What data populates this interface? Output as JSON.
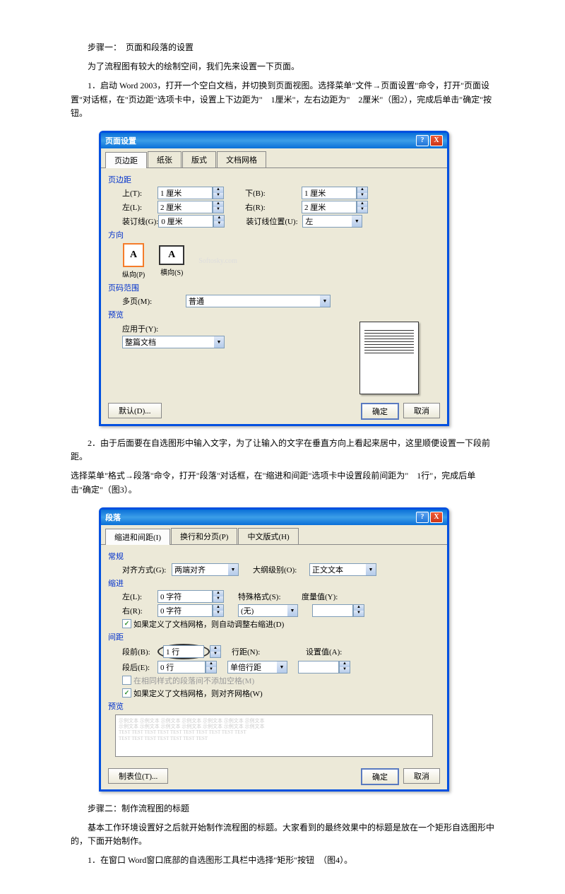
{
  "step1_title": "步骤一：　页面和段落的设置",
  "intro1": "为了流程图有较大的绘制空间，我们先来设置一下页面。",
  "para1": "1．启动 Word 2003，打开一个空白文档，并切换到页面视图。选择菜单\"文件→页面设置\"命令，打开\"页面设置\"对话框，在\"页边距\"选项卡中，设置上下边距为\"　1厘米\"，左右边距为\"　2厘米\"（图2），完成后单击\"确定\"按钮。",
  "dialog1": {
    "title": "页面设置",
    "tabs": [
      "页边距",
      "纸张",
      "版式",
      "文档网格"
    ],
    "group_margin": "页边距",
    "label_top": "上(T):",
    "label_bottom": "下(B):",
    "label_left": "左(L):",
    "label_right": "右(R):",
    "label_gutter": "装订线(G):",
    "label_gutter_pos": "装订线位置(U):",
    "val_top": "1 厘米",
    "val_bottom": "1 厘米",
    "val_left": "2 厘米",
    "val_right": "2 厘米",
    "val_gutter": "0 厘米",
    "val_gutter_pos": "左",
    "group_orient": "方向",
    "orient_portrait": "纵向(P)",
    "orient_landscape": "横向(S)",
    "group_range": "页码范围",
    "label_multipage": "多页(M):",
    "val_multipage": "普通",
    "group_preview": "预览",
    "label_applyto": "应用于(Y):",
    "val_applyto": "整篇文档",
    "btn_default": "默认(D)...",
    "btn_ok": "确定",
    "btn_cancel": "取消",
    "watermark": "Softosky.com"
  },
  "para2a": "2．由于后面要在自选图形中输入文字，为了让输入的文字在垂直方向上看起来居中，这里顺便设置一下段前距。",
  "para2b": "选择菜单\"格式→段落\"命令，打开\"段落\"对话框，在\"缩进和间距\"选项卡中设置段前间距为\"　1行\"，完成后单击\"确定\"（图3）。",
  "dialog2": {
    "title": "段落",
    "tabs": [
      "缩进和间距(I)",
      "换行和分页(P)",
      "中文版式(H)"
    ],
    "group_general": "常规",
    "label_align": "对齐方式(G):",
    "val_align": "两端对齐",
    "label_outline": "大纲级别(O):",
    "val_outline": "正文文本",
    "group_indent": "缩进",
    "label_left": "左(L):",
    "val_left": "0 字符",
    "label_right": "右(R):",
    "val_right": "0 字符",
    "label_special": "特殊格式(S):",
    "val_special": "(无)",
    "label_by": "度量值(Y):",
    "val_by": "",
    "chk_autofit": "如果定义了文档网格，则自动调整右缩进(D)",
    "group_spacing": "间距",
    "label_before": "段前(B):",
    "val_before": "1 行",
    "label_after": "段后(E):",
    "val_after": "0 行",
    "label_linespace": "行距(N):",
    "val_linespace": "单倍行距",
    "label_at": "设置值(A):",
    "val_at": "",
    "chk_nospace": "在相同样式的段落间不添加空格(M)",
    "chk_snap": "如果定义了文档网格，则对齐网格(W)",
    "group_preview": "预览",
    "btn_tabs": "制表位(T)...",
    "btn_ok": "确定",
    "btn_cancel": "取消"
  },
  "step2_title": "步骤二：制作流程图的标题",
  "para3": "基本工作环境设置好之后就开始制作流程图的标题。大家看到的最终效果中的标题是放在一个矩形自选图形中的，下面开始制作。",
  "para4": "1．在窗口 Word窗口底部的自选图形工具栏中选择\"矩形\"按钮　（图4）。"
}
